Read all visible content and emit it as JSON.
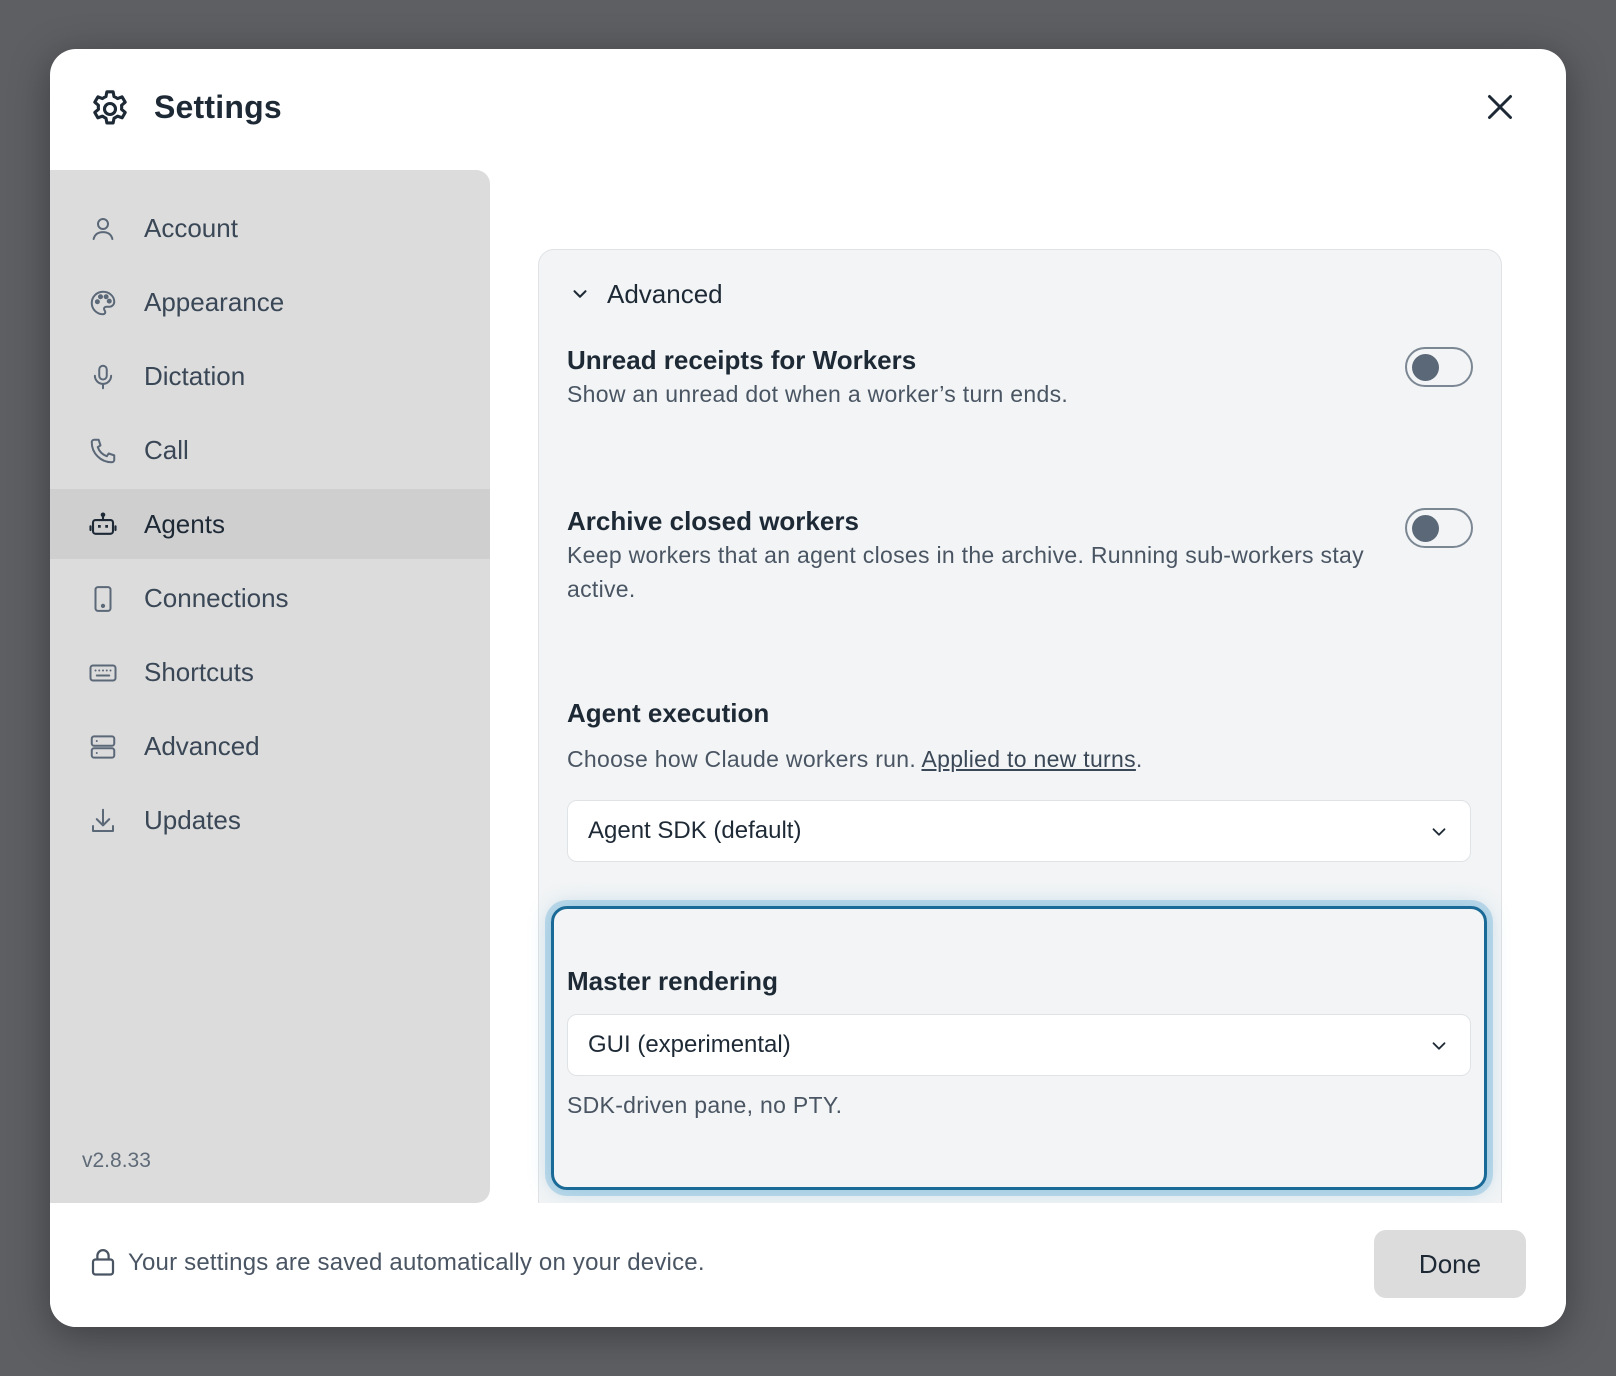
{
  "header": {
    "title": "Settings"
  },
  "sidebar": {
    "items": [
      {
        "label": "Account",
        "icon": "user-icon",
        "active": false
      },
      {
        "label": "Appearance",
        "icon": "palette-icon",
        "active": false
      },
      {
        "label": "Dictation",
        "icon": "microphone-icon",
        "active": false
      },
      {
        "label": "Call",
        "icon": "phone-icon",
        "active": false
      },
      {
        "label": "Agents",
        "icon": "robot-icon",
        "active": true
      },
      {
        "label": "Connections",
        "icon": "device-icon",
        "active": false
      },
      {
        "label": "Shortcuts",
        "icon": "keyboard-icon",
        "active": false
      },
      {
        "label": "Advanced",
        "icon": "server-icon",
        "active": false
      },
      {
        "label": "Updates",
        "icon": "download-icon",
        "active": false
      }
    ],
    "version": "v2.8.33"
  },
  "panel": {
    "title": "Advanced",
    "unread": {
      "title": "Unread receipts for Workers",
      "desc": "Show an unread dot when a worker’s turn ends.",
      "enabled": false
    },
    "archive": {
      "title": "Archive closed workers",
      "desc": "Keep workers that an agent closes in the archive. Running sub-workers stay active.",
      "enabled": false
    },
    "execution": {
      "title": "Agent execution",
      "desc_prefix": "Choose how Claude workers run. ",
      "desc_link": "Applied to new turns",
      "desc_suffix": ".",
      "selected": "Agent SDK (default)"
    },
    "rendering": {
      "title": "Master rendering",
      "selected": "GUI (experimental)",
      "desc": "SDK-driven pane, no PTY."
    }
  },
  "footer": {
    "note": "Your settings are saved automatically on your device.",
    "done_label": "Done"
  },
  "colors": {
    "accent_focus": "#1a6a97",
    "sidebar_bg": "#dcdcdc",
    "panel_bg": "#f2f4f5"
  }
}
